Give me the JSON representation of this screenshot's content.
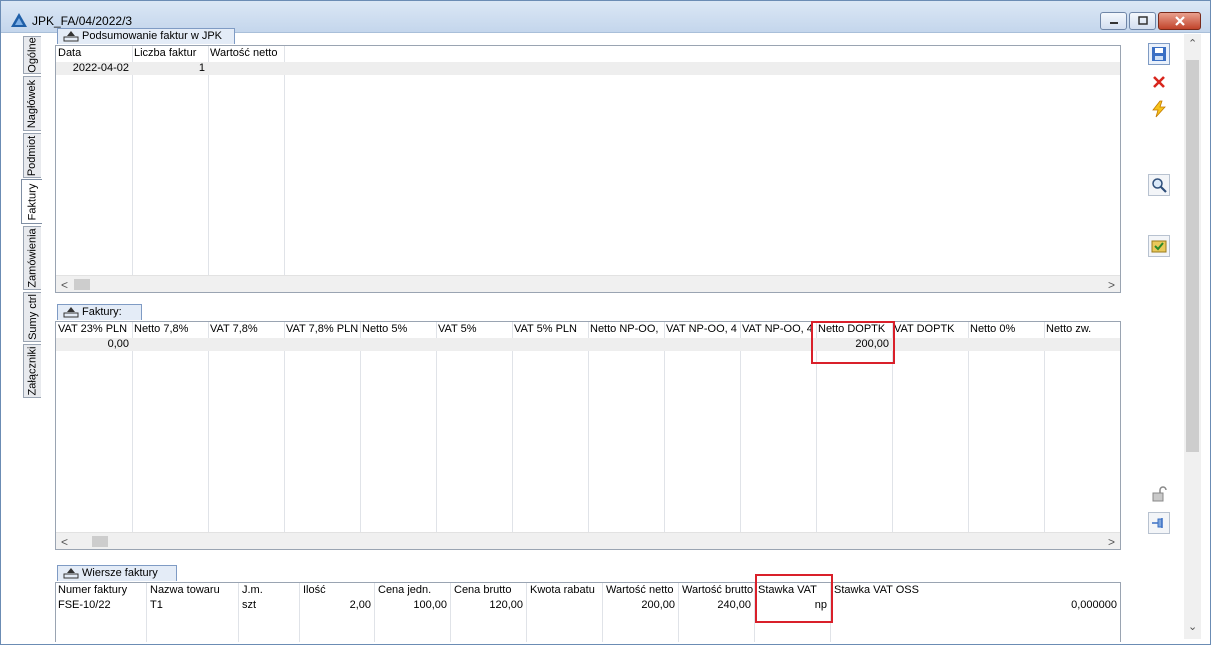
{
  "window": {
    "title": "JPK_FA/04/2022/3"
  },
  "vertical_tabs": [
    "Ogólne",
    "Nagłówek",
    "Podmiot",
    "Faktury",
    "Zamówienia",
    "Sumy ctrl",
    "Załączniki"
  ],
  "summary": {
    "title": "Podsumowanie faktur w JPK",
    "columns": [
      "Data",
      "Liczba faktur",
      "Wartość netto"
    ],
    "rows": [
      [
        "2022-04-02",
        "1",
        ""
      ]
    ]
  },
  "invoices": {
    "title": "Faktury:",
    "columns": [
      "VAT 23% PLN",
      "Netto 7,8%",
      "VAT 7,8%",
      "VAT 7,8% PLN",
      "Netto 5%",
      "VAT 5%",
      "VAT 5% PLN",
      "Netto NP-OO,",
      "VAT  NP-OO, 4",
      "VAT  NP-OO, 4",
      "Netto DOPTK",
      "VAT DOPTK",
      "Netto 0%",
      "Netto zw."
    ],
    "rows": [
      [
        "0,00",
        "",
        "",
        "",
        "",
        "",
        "",
        "",
        "",
        "",
        "200,00",
        "",
        "",
        ""
      ]
    ]
  },
  "invoice_lines": {
    "title": "Wiersze faktury",
    "columns": [
      "Numer faktury",
      "Nazwa towaru",
      "J.m.",
      "Ilość",
      "Cena jedn.",
      "Cena brutto",
      "Kwota rabatu",
      "Wartość netto",
      "Wartość brutto",
      "Stawka VAT",
      "Stawka VAT OSS",
      ""
    ],
    "rows": [
      [
        "FSE-10/22",
        "T1",
        "szt",
        "2,00",
        "100,00",
        "120,00",
        "",
        "200,00",
        "240,00",
        "np",
        "",
        "0,000000"
      ]
    ]
  },
  "toolbar_icons": [
    "save-icon",
    "delete-icon",
    "lightning-icon",
    "magnifier-icon",
    "checked-folder-icon",
    "unlock-icon",
    "pin-icon"
  ]
}
